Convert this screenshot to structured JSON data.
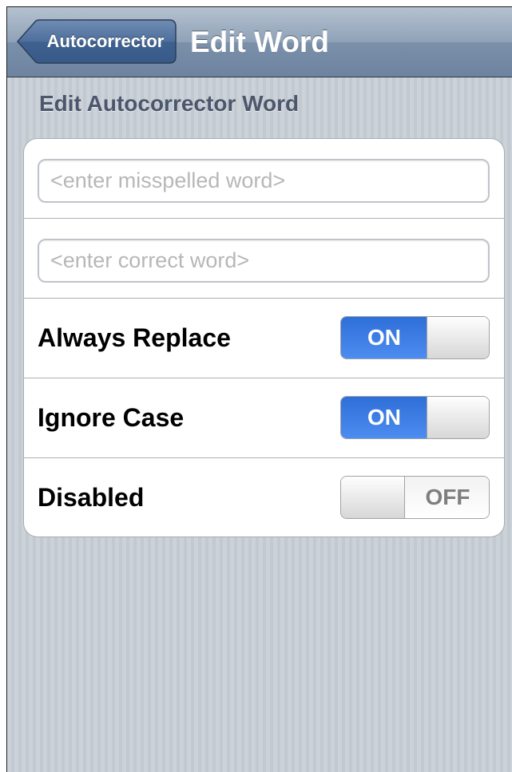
{
  "navbar": {
    "back_label": "Autocorrector",
    "title": "Edit Word"
  },
  "section": {
    "header": "Edit Autocorrector Word"
  },
  "fields": {
    "misspelled": {
      "value": "",
      "placeholder": "<enter misspelled word>"
    },
    "correct": {
      "value": "",
      "placeholder": "<enter correct word>"
    }
  },
  "settings": [
    {
      "label": "Always Replace",
      "state": "ON",
      "on": true
    },
    {
      "label": "Ignore Case",
      "state": "ON",
      "on": true
    },
    {
      "label": "Disabled",
      "state": "OFF",
      "on": false
    }
  ],
  "colors": {
    "switch_on": "#3f7fe6",
    "switch_off_text": "#7f7f7f",
    "navbar": "#7b90a9",
    "background": "#c5ccd4",
    "section_header": "#4c566c"
  },
  "icons": {
    "back": "chevron-left-arrow-button"
  }
}
